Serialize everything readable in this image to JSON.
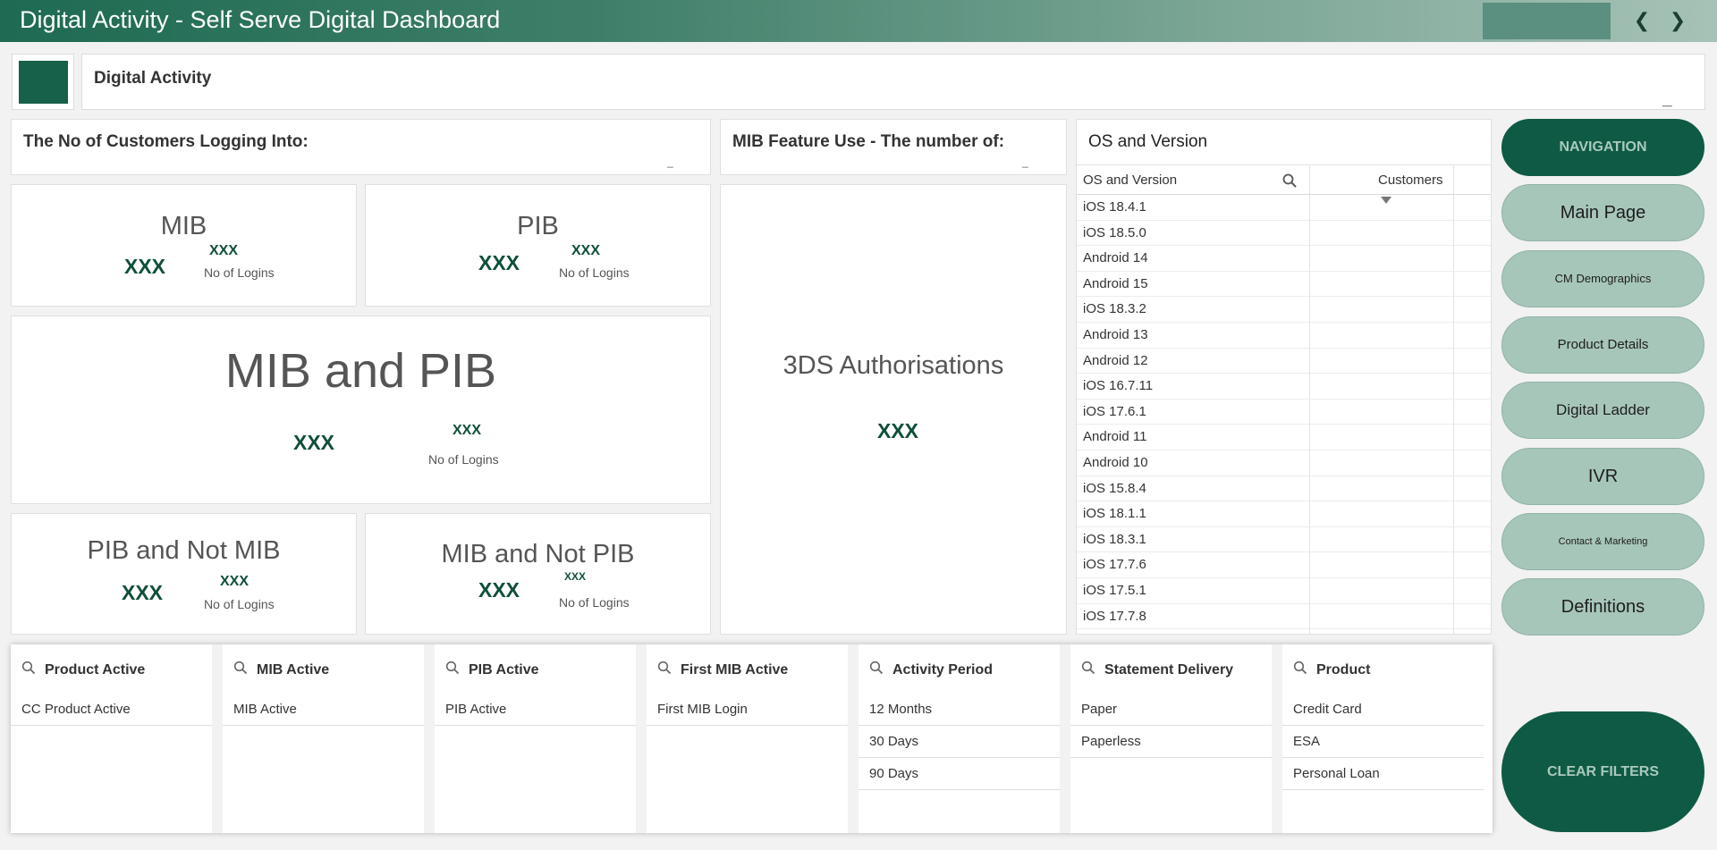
{
  "app": {
    "title": "Digital Activity - Self Serve Digital Dashboard"
  },
  "sheet": {
    "title": "Digital Activity"
  },
  "logins_header": {
    "title": "The No of Customers Logging Into:"
  },
  "mib_feature_header": {
    "title": "MIB Feature Use - The number of:"
  },
  "minimize_glyph": "_",
  "kpis": {
    "mib": {
      "title": "MIB",
      "value": "XXX",
      "logins": "XXX",
      "logins_label": "No of Logins"
    },
    "pib": {
      "title": "PIB",
      "value": "XXX",
      "logins": "XXX",
      "logins_label": "No of Logins"
    },
    "mib_and_pib": {
      "title": "MIB and PIB",
      "value": "XXX",
      "logins": "XXX",
      "logins_label": "No of Logins"
    },
    "pib_not_mib": {
      "title": "PIB and Not MIB",
      "value": "XXX",
      "logins": "XXX",
      "logins_label": "No of Logins"
    },
    "mib_not_pib": {
      "title": "MIB and Not PIB",
      "value": "XXX",
      "logins": "XXX",
      "logins_label": "No of Logins"
    },
    "three_ds": {
      "title": "3DS Authorisations",
      "value": "XXX"
    }
  },
  "os_table": {
    "title": "OS and Version",
    "columns": [
      "OS and Version",
      "Customers"
    ],
    "rows": [
      "iOS 18.4.1",
      "iOS 18.5.0",
      "Android 14",
      "Android 15",
      "iOS 18.3.2",
      "Android 13",
      "Android 12",
      "iOS 16.7.11",
      "iOS 17.6.1",
      "Android 11",
      "Android 10",
      "iOS 15.8.4",
      "iOS 18.1.1",
      "iOS 18.3.1",
      "iOS 17.7.6",
      "iOS 17.5.1",
      "iOS 17.7.8"
    ]
  },
  "navigation": {
    "header": "NAVIGATION",
    "buttons": [
      "Main Page",
      "CM Demographics",
      "Product Details",
      "Digital Ladder",
      "IVR",
      "Contact & Marketing",
      "Definitions"
    ],
    "clear": "CLEAR FILTERS"
  },
  "filters": [
    {
      "label": "Product Active",
      "items": [
        "CC Product Active"
      ]
    },
    {
      "label": "MIB Active",
      "items": [
        "MIB Active"
      ]
    },
    {
      "label": "PIB Active",
      "items": [
        "PIB Active"
      ]
    },
    {
      "label": "First MIB Active",
      "items": [
        "First MIB Login"
      ]
    },
    {
      "label": "Activity Period",
      "items": [
        "12 Months",
        "30 Days",
        "90 Days"
      ]
    },
    {
      "label": "Statement Delivery",
      "items": [
        "Paper",
        "Paperless"
      ]
    },
    {
      "label": "Product",
      "items": [
        "Credit Card",
        "ESA",
        "Personal Loan"
      ]
    }
  ],
  "colors": {
    "brand": "#0f5a44",
    "nav_light": "#a7c6ba",
    "kpi_value": "#104f3c"
  }
}
